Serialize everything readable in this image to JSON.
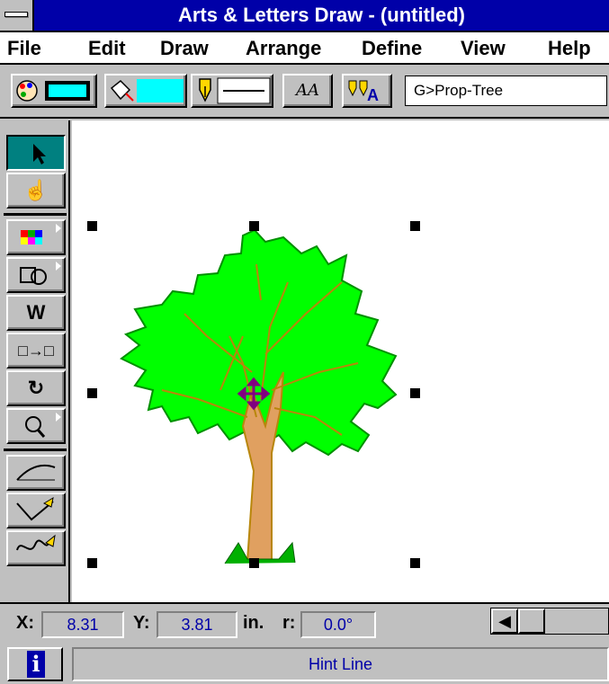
{
  "window": {
    "title": "Arts & Letters Draw - (untitled)"
  },
  "menu": [
    "File",
    "Edit",
    "Draw",
    "Arrange",
    "Define",
    "View",
    "Help"
  ],
  "toolbar": {
    "color_swatch": "#00ffff",
    "fill_swatch": "#00ffff",
    "text_button": "AA",
    "symbol_field": "G>Prop-Tree"
  },
  "toolbox": [
    {
      "name": "pointer-tool",
      "glyph": "➤",
      "active": true
    },
    {
      "name": "hand-tool",
      "glyph": "☝"
    },
    {
      "name": "clip-art-tool",
      "glyph": "▦"
    },
    {
      "name": "shapes-tool",
      "glyph": "◩"
    },
    {
      "name": "text-tool",
      "glyph": "W"
    },
    {
      "name": "transform-tool",
      "glyph": "⧉"
    },
    {
      "name": "rotate-tool",
      "glyph": "↻"
    },
    {
      "name": "zoom-tool",
      "glyph": "🔍"
    },
    {
      "name": "bezier-tool",
      "glyph": "⌒"
    },
    {
      "name": "pen-tool",
      "glyph": "✎"
    },
    {
      "name": "freehand-tool",
      "glyph": "✍"
    }
  ],
  "status": {
    "x_label": "X:",
    "x_value": "8.31",
    "y_label": "Y:",
    "y_value": "3.81",
    "unit": "in.",
    "r_label": "r:",
    "r_value": "0.0°",
    "hint": "Hint Line"
  },
  "colors": {
    "title_bg": "#0000a8",
    "leaf": "#00ff00",
    "trunk": "#b8860b",
    "selected_tool": "#008080"
  }
}
